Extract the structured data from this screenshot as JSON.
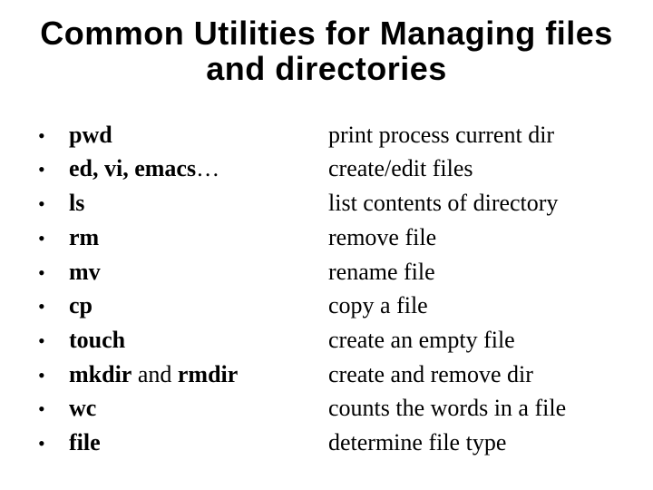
{
  "title": "Common Utilities for Managing files and directories",
  "items": [
    {
      "cmd_bold": "pwd",
      "cmd_rest": "",
      "desc": "print process current dir"
    },
    {
      "cmd_bold": "ed, vi, emacs",
      "cmd_rest": "…",
      "desc": "create/edit files"
    },
    {
      "cmd_bold": "ls",
      "cmd_rest": "",
      "desc": "list contents of directory"
    },
    {
      "cmd_bold": "rm",
      "cmd_rest": "",
      "desc": "remove file"
    },
    {
      "cmd_bold": "mv",
      "cmd_rest": "",
      "desc": "rename file"
    },
    {
      "cmd_bold": "cp",
      "cmd_rest": "",
      "desc": "copy a file"
    },
    {
      "cmd_bold": "touch",
      "cmd_rest": "",
      "desc": "create an empty file"
    },
    {
      "cmd_bold": "mkdir",
      "cmd_mid": " and ",
      "cmd_bold2": "rmdir",
      "desc": "create and remove dir"
    },
    {
      "cmd_bold": "wc",
      "cmd_rest": "",
      "desc": "counts the words in a file"
    },
    {
      "cmd_bold": "file",
      "cmd_rest": "",
      "desc": "determine file type"
    }
  ],
  "bullet_glyph": "•"
}
